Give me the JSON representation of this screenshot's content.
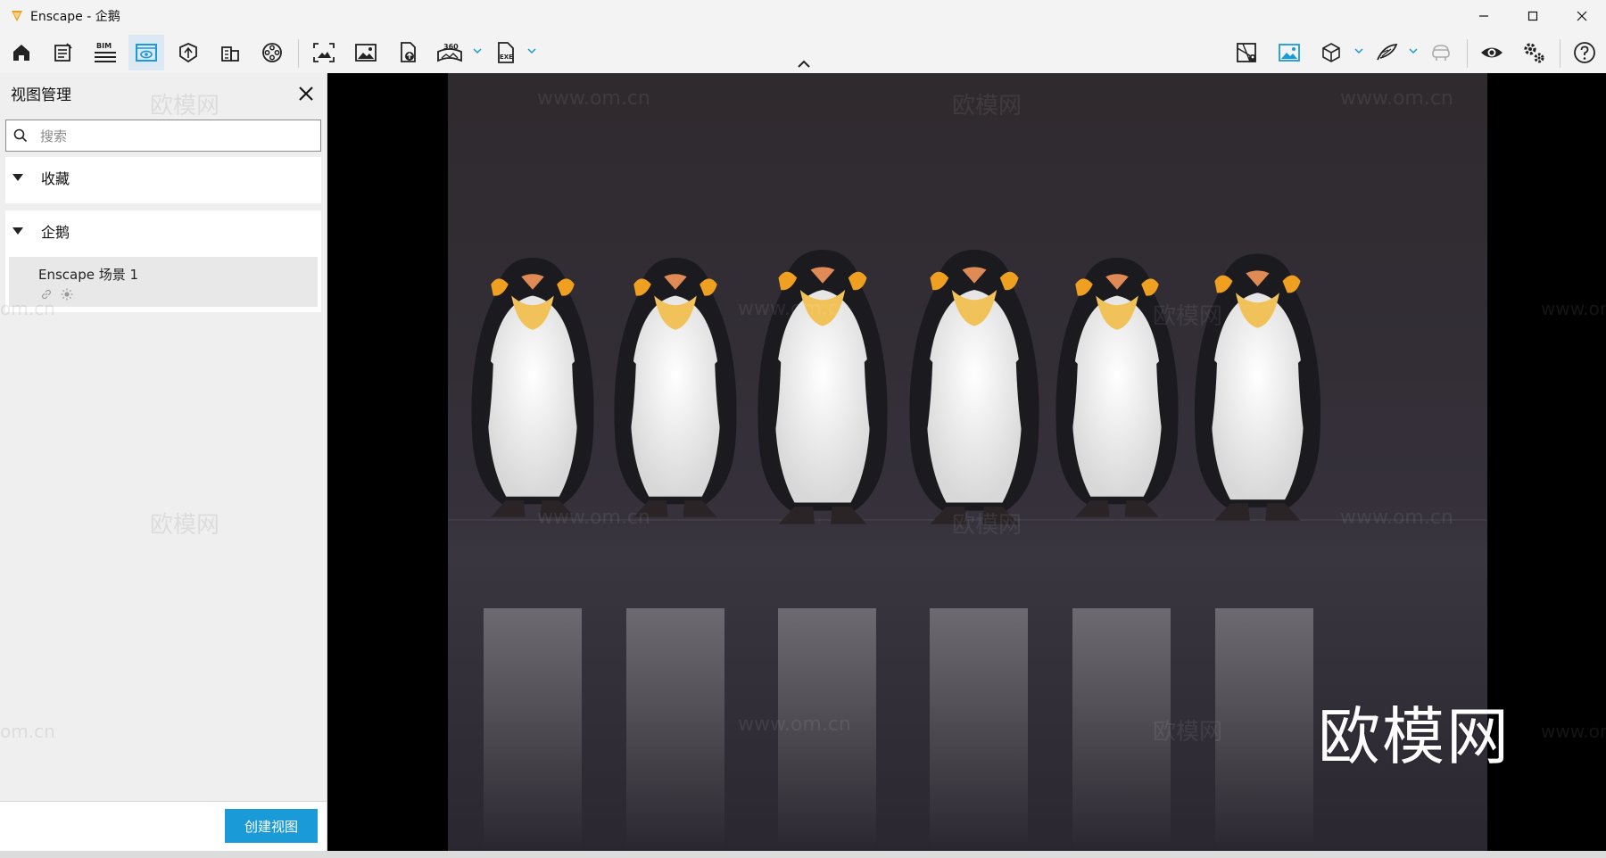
{
  "window": {
    "title": "Enscape - 企鹅",
    "controls": [
      "minimize",
      "maximize",
      "close"
    ]
  },
  "toolbar": {
    "left_icons": [
      "home-icon",
      "notes-icon",
      "bim-icon",
      "view-manager-icon",
      "material-icon",
      "building-icon",
      "film-icon",
      "screenshot-icon",
      "image-icon",
      "upload-icon",
      "panorama-360-icon",
      "exe-export-icon"
    ],
    "bim_label": "BIM",
    "pano_label": "360",
    "exe_label": "EXE",
    "right_icons": [
      "map-icon",
      "image-settings-icon",
      "cube-icon",
      "feather-icon",
      "vr-headset-icon",
      "eye-icon",
      "settings-icon",
      "help-icon"
    ],
    "active": "view-manager-icon"
  },
  "view_panel": {
    "title": "视图管理",
    "search": {
      "placeholder": "搜索",
      "value": ""
    },
    "sections": [
      {
        "label": "收藏",
        "expanded": true,
        "items": []
      },
      {
        "label": "企鹅",
        "expanded": true,
        "items": [
          {
            "name": "Enscape 场景 1"
          }
        ]
      }
    ],
    "create_button": "创建视图"
  },
  "viewport": {
    "watermark_url": "www.om.cn",
    "watermark_brand": "欧模网",
    "watermark_partial": "om.cn",
    "brand_overlay": "欧模网",
    "subject_count": 6
  },
  "colors": {
    "accent": "#1a9ad6",
    "active_tab_bg": "#dce8f3",
    "panel_bg": "#efefef",
    "viewport_bg": "#000000"
  }
}
